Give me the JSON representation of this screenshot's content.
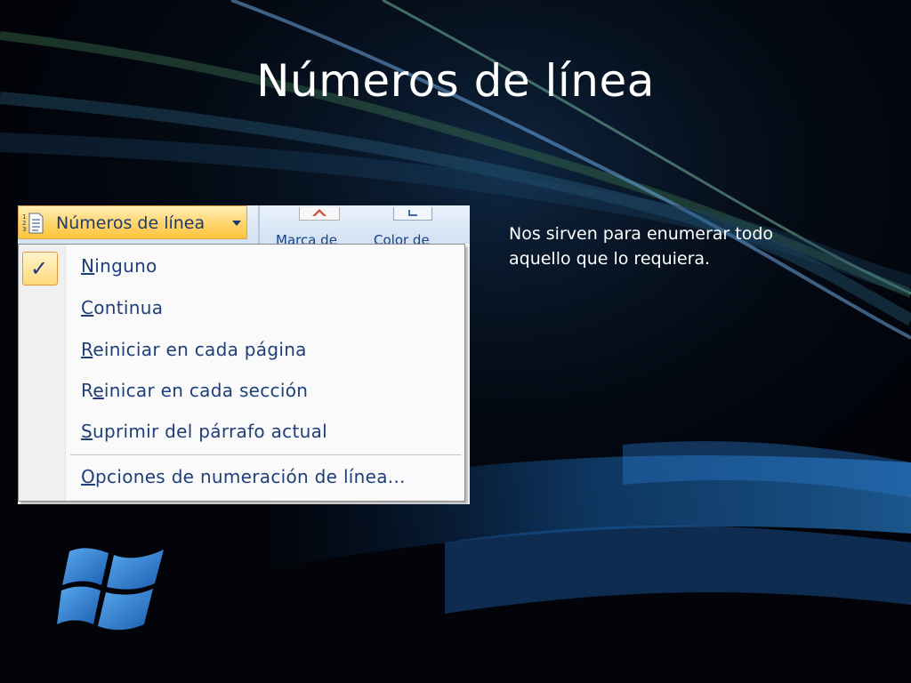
{
  "slide": {
    "title": "Números de línea",
    "description": "Nos sirven para enumerar todo aquello que lo requiera."
  },
  "screenshot": {
    "dropdown_button": {
      "label": "Números de línea",
      "icon": "line-numbers-icon",
      "arrow_icon": "chevron-down-icon"
    },
    "ribbon_labels": [
      "Marca de",
      "Color de"
    ],
    "menu": {
      "items": [
        {
          "access_key": "N",
          "rest": "inguno",
          "checked": true
        },
        {
          "access_key": "C",
          "rest": "ontinua",
          "checked": false
        },
        {
          "access_key": "R",
          "rest": "einiciar en cada página",
          "checked": false
        },
        {
          "before": "R",
          "access_key": "e",
          "rest": "inicar en cada sección",
          "checked": false
        },
        {
          "access_key": "S",
          "rest": "uprimir del párrafo actual",
          "checked": false
        },
        {
          "access_key": "O",
          "rest": "pciones de numeración de línea...",
          "checked": false
        }
      ],
      "check_icon": "check-icon"
    }
  },
  "logo": {
    "icon": "windows-logo-icon"
  },
  "colors": {
    "background": "#02040a",
    "highlight": "#ffd46b",
    "menu_text": "#1e3f7a",
    "ribbon": "#d3e1f2"
  }
}
